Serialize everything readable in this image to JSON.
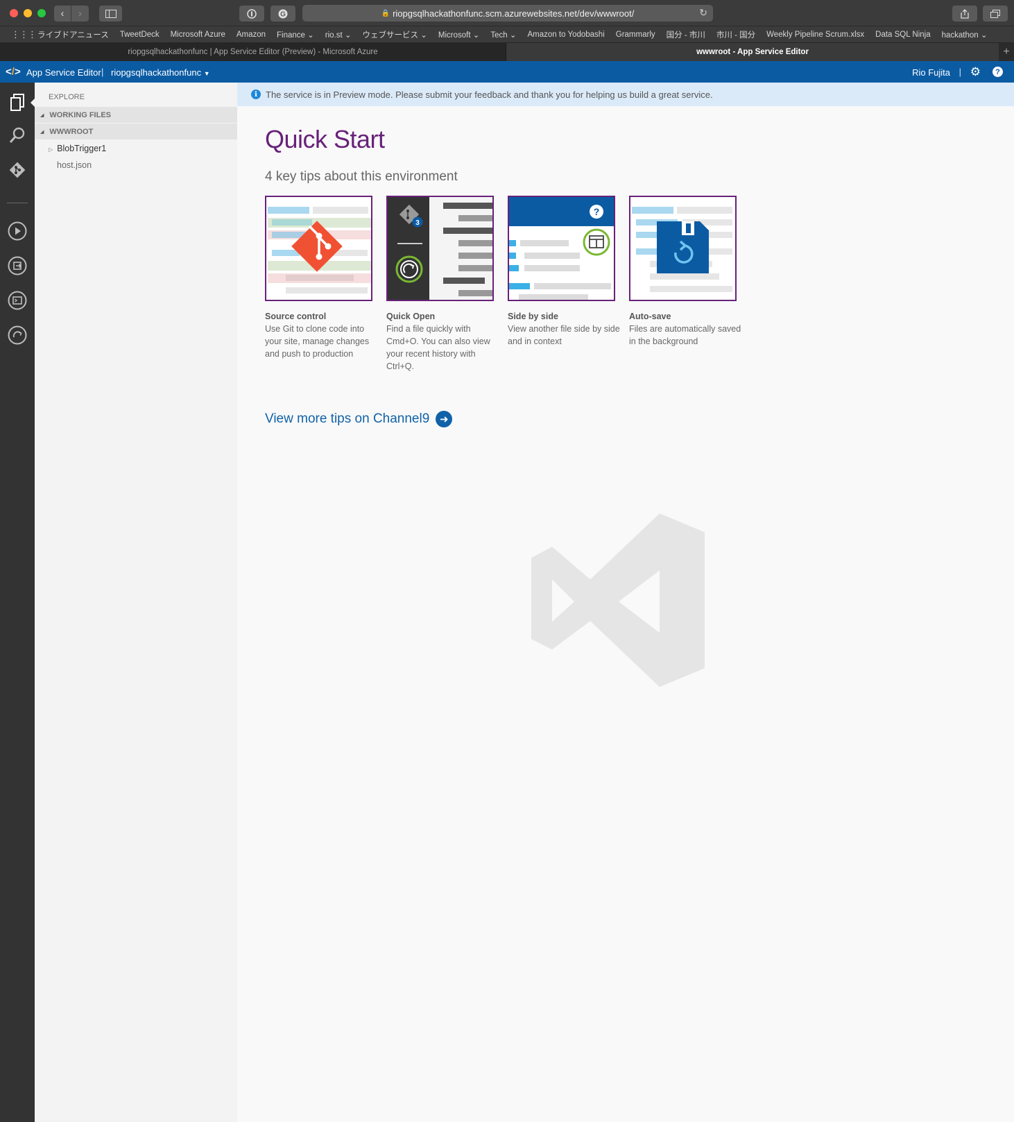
{
  "browser": {
    "url": "riopgsqlhackathonfunc.scm.azurewebsites.net/dev/wwwroot/",
    "bookmarks": [
      "ライブドアニュース",
      "TweetDeck",
      "Microsoft Azure",
      "Amazon",
      "Finance ⌄",
      "rio.st ⌄",
      "ウェブサービス ⌄",
      "Microsoft ⌄",
      "Tech ⌄",
      "Amazon to Yodobashi",
      "Grammarly",
      "国分 - 市川",
      "市川 - 国分",
      "Weekly Pipeline Scrum.xlsx",
      "Data SQL Ninja",
      "hackathon ⌄"
    ],
    "tabs": [
      {
        "label": "riopgsqlhackathonfunc | App Service Editor (Preview) - Microsoft Azure",
        "active": false
      },
      {
        "label": "wwwroot - App Service Editor",
        "active": true
      }
    ]
  },
  "header": {
    "app_title": "App Service Editor",
    "site_name": "riopgsqlhackathonfunc",
    "user_name": "Rio Fujita"
  },
  "sidebar": {
    "explore_label": "EXPLORE",
    "working_files_label": "WORKING FILES",
    "wwwroot_label": "WWWROOT",
    "items": [
      {
        "label": "BlobTrigger1",
        "type": "folder"
      },
      {
        "label": "host.json",
        "type": "file"
      }
    ]
  },
  "main": {
    "banner_text": "The service is in Preview mode. Please submit your feedback and thank you for helping us build a great service.",
    "title": "Quick Start",
    "subtitle": "4 key tips about this environment",
    "tips": [
      {
        "title": "Source control",
        "desc": "Use Git to clone code into your site, manage changes and push to production"
      },
      {
        "title": "Quick Open",
        "desc": "Find a file quickly with Cmd+O. You can also view your recent history with Ctrl+Q."
      },
      {
        "title": "Side by side",
        "desc": "View another file side by side and in context"
      },
      {
        "title": "Auto-save",
        "desc": "Files are automatically saved in the background"
      }
    ],
    "more_link": "View more tips on Channel9",
    "badge_count": "3"
  },
  "colors": {
    "accent": "#0b5ba3",
    "title_purple": "#68217a",
    "git_orange": "#f05133",
    "link_blue": "#1062a8"
  }
}
